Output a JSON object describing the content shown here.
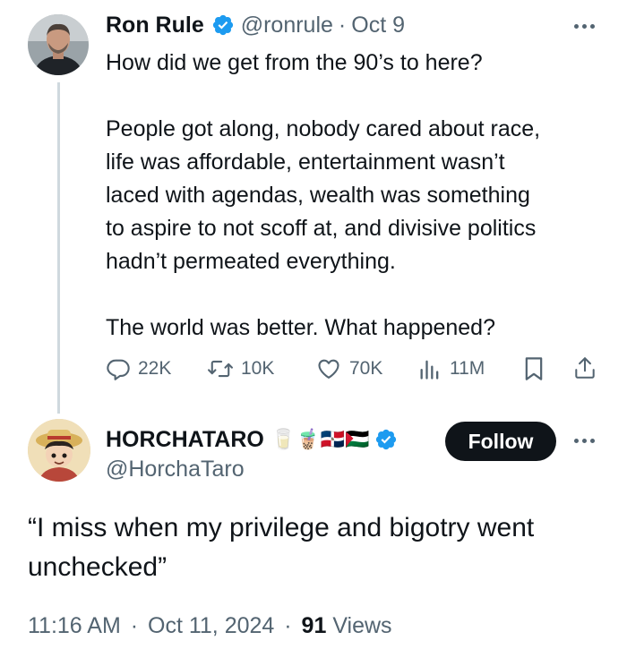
{
  "tweet": {
    "author_name": "Ron Rule",
    "handle": "@ronrule",
    "separator": "·",
    "date": "Oct 9",
    "lines": [
      "How did we get from the 90’s to here?",
      "",
      "People got along, nobody cared about race,",
      "life was affordable, entertainment wasn’t",
      "laced with agendas, wealth was something",
      "to aspire to not scoff at, and divisive politics",
      "hadn’t permeated everything.",
      "",
      "The world was better. What happened?"
    ],
    "stats": {
      "replies": "22K",
      "reposts": "10K",
      "likes": "70K",
      "views": "11M"
    }
  },
  "reply": {
    "author_name": "HORCHATARO",
    "name_emoji": "🥛🧋🇩🇴🇵🇸",
    "handle": "@HorchaTaro",
    "follow_label": "Follow",
    "lines": [
      "“I miss when my privilege and bigotry went",
      "unchecked”"
    ],
    "time": "11:16 AM",
    "sep1": "·",
    "date": "Oct 11, 2024",
    "sep2": "·",
    "views_count": "91",
    "views_label": "Views"
  },
  "colors": {
    "verified": "#1d9bf0",
    "text": "#0f1419",
    "muted": "#536471",
    "thread_line": "#cfd9de"
  }
}
